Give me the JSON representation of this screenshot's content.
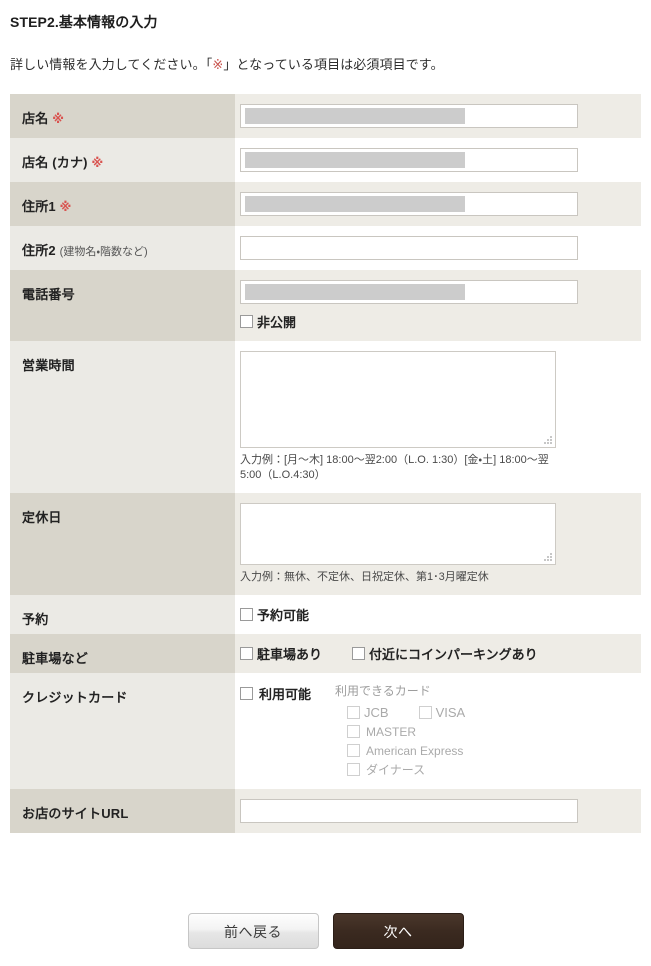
{
  "header": {
    "step_title": "STEP2.基本情報の入力",
    "description_before": "詳しい情報を入力してください。「",
    "description_mark": "※",
    "description_after": "」となっている項目は必須項目です。"
  },
  "required_mark": "※",
  "rows": {
    "shop_name": {
      "label": "店名",
      "required": true,
      "input_value": ""
    },
    "shop_name_kana": {
      "label": "店名 (カナ)",
      "required": true,
      "input_value": ""
    },
    "address1": {
      "label": "住所1",
      "required": true,
      "input_value": ""
    },
    "address2": {
      "label": "住所2",
      "sub_label": "(建物名・階数など)",
      "required": false,
      "input_value": ""
    },
    "phone": {
      "label": "電話番号",
      "required": false,
      "input_value": "",
      "private_checkbox_label": "非公開"
    },
    "business_hours": {
      "label": "営業時間",
      "textarea_value": "",
      "hint": "入力例：[月〜木] 18:00〜翌2:00（L.O. 1:30）[金・土] 18:00〜翌5:00（L.O.4:30）"
    },
    "closed_days": {
      "label": "定休日",
      "textarea_value": "",
      "hint": "入力例：無休、不定休、日祝定休、第1･3月曜定休"
    },
    "reservation": {
      "label": "予約",
      "checkbox_label": "予約可能"
    },
    "parking": {
      "label": "駐車場など",
      "checkbox1_label": "駐車場あり",
      "checkbox2_label": "付近にコインパーキングあり"
    },
    "credit_card": {
      "label": "クレジットカード",
      "available_label": "利用可能",
      "cards_title": "利用できるカード",
      "cards": [
        {
          "label": "JCB",
          "disabled": true
        },
        {
          "label": "VISA",
          "disabled": true
        },
        {
          "label": "MASTER",
          "disabled": true
        },
        {
          "label": "American Express",
          "disabled": true
        },
        {
          "label": "ダイナース",
          "disabled": true
        }
      ]
    },
    "site_url": {
      "label": "お店のサイトURL",
      "input_value": ""
    }
  },
  "buttons": {
    "back_label": "前へ戻る",
    "next_label": "次へ"
  },
  "colors": {
    "label_odd_bg": "#d8d5cb",
    "label_even_bg": "#ebeae5",
    "value_odd_bg": "#eeece6",
    "value_even_bg": "#ffffff",
    "required_red": "#c9544e",
    "next_button_bg": "#3b2a20",
    "redaction_gray": "#cccccc",
    "disabled_text": "#aaaaaa"
  }
}
